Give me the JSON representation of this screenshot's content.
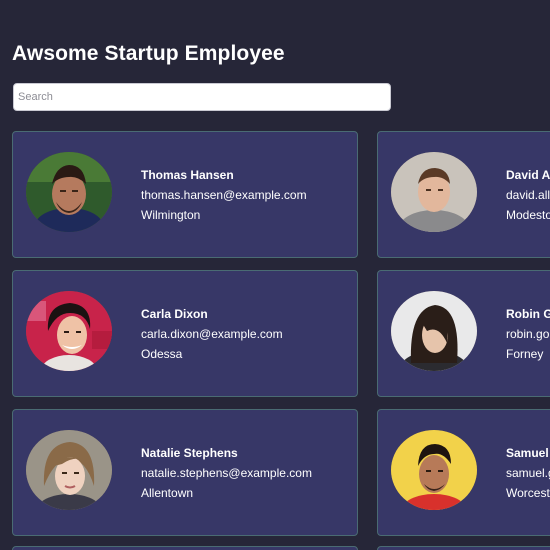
{
  "header": {
    "title": "Awsome Startup Employee"
  },
  "search": {
    "placeholder": "Search",
    "value": ""
  },
  "employees": [
    {
      "name": "Thomas Hansen",
      "email": "thomas.hansen@example.com",
      "city": "Wilmington"
    },
    {
      "name": "David A",
      "email": "david.all",
      "city": "Modesto"
    },
    {
      "name": "Carla Dixon",
      "email": "carla.dixon@example.com",
      "city": "Odessa"
    },
    {
      "name": "Robin G",
      "email": "robin.go",
      "city": "Forney"
    },
    {
      "name": "Natalie Stephens",
      "email": "natalie.stephens@example.com",
      "city": "Allentown"
    },
    {
      "name": "Samuel",
      "email": "samuel.g",
      "city": "Worcest"
    }
  ],
  "colors": {
    "background": "#262638",
    "card": "#373767",
    "card_border": "#4a6b73",
    "text": "#ffffff"
  }
}
